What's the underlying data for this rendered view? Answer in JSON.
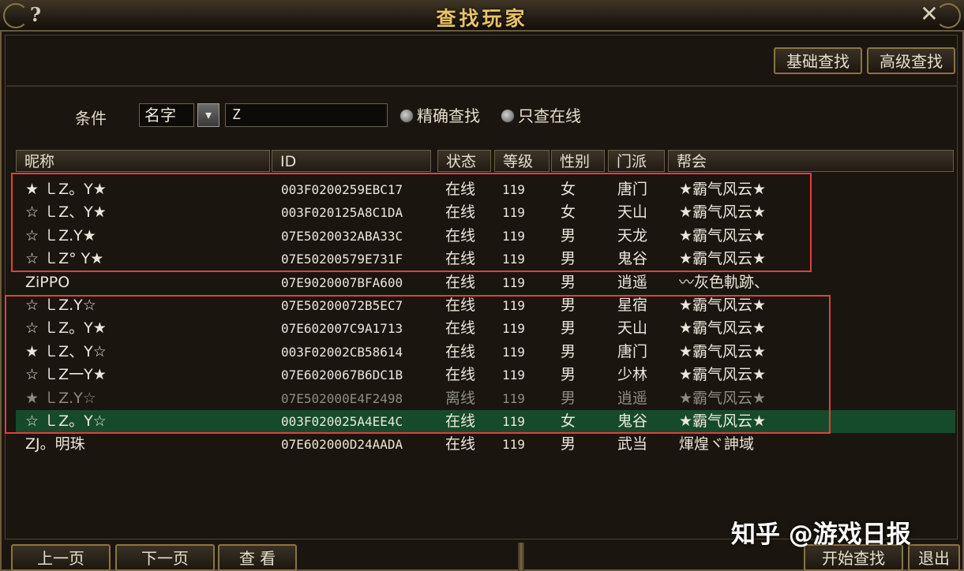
{
  "window": {
    "title": "查找玩家",
    "help_glyph": "?",
    "close_glyph": "✕"
  },
  "tabs": {
    "basic": "基础查找",
    "advanced": "高级查找"
  },
  "search": {
    "condition_label": "条件",
    "field_selected": "名字",
    "dropdown_glyph": "▾",
    "query_value": "Z",
    "exact_label": "精确查找",
    "online_only_label": "只查在线"
  },
  "table": {
    "headers": [
      "昵称",
      "ID",
      "状态",
      "等级",
      "性别",
      "门派",
      "帮会"
    ],
    "rows": [
      {
        "nick": "★ ㇄Z。Y★",
        "id": "003F0200259EBC17",
        "status": "在线",
        "level": "119",
        "gender": "女",
        "school": "唐门",
        "guild": "★霸气风云★"
      },
      {
        "nick": "☆ ㇄Z、Y★",
        "id": "003F020125A8C1DA",
        "status": "在线",
        "level": "119",
        "gender": "女",
        "school": "天山",
        "guild": "★霸气风云★"
      },
      {
        "nick": "☆ ㇄Z.Y★",
        "id": "07E5020032ABA33C",
        "status": "在线",
        "level": "119",
        "gender": "男",
        "school": "天龙",
        "guild": "★霸气风云★"
      },
      {
        "nick": "☆ ㇄Z° Y★",
        "id": "07E50200579E731F",
        "status": "在线",
        "level": "119",
        "gender": "男",
        "school": "鬼谷",
        "guild": "★霸气风云★"
      },
      {
        "nick": "ZiPPO",
        "id": "07E9020007BFA600",
        "status": "在线",
        "level": "119",
        "gender": "男",
        "school": "逍遥",
        "guild": "〰灰色軌跡、"
      },
      {
        "nick": "☆ ㇄Z.Y☆",
        "id": "07E50200072B5EC7",
        "status": "在线",
        "level": "119",
        "gender": "男",
        "school": "星宿",
        "guild": "★霸气风云★"
      },
      {
        "nick": "☆ ㇄Z。Y★",
        "id": "07E602007C9A1713",
        "status": "在线",
        "level": "119",
        "gender": "男",
        "school": "天山",
        "guild": "★霸气风云★"
      },
      {
        "nick": "★ ㇄Z、Y☆",
        "id": "003F02002CB58614",
        "status": "在线",
        "level": "119",
        "gender": "男",
        "school": "唐门",
        "guild": "★霸气风云★"
      },
      {
        "nick": "☆ ㇄Z一Y★",
        "id": "07E6020067B6DC1B",
        "status": "在线",
        "level": "119",
        "gender": "男",
        "school": "少林",
        "guild": "★霸气风云★"
      },
      {
        "nick": "★ ㇄Z.Y☆",
        "id": "07E502000E4F2498",
        "status": "离线",
        "level": "119",
        "gender": "男",
        "school": "逍遥",
        "guild": "★霸气风云★"
      },
      {
        "nick": "☆ ㇄Z。Y☆",
        "id": "003F020025A4EE4C",
        "status": "在线",
        "level": "119",
        "gender": "女",
        "school": "鬼谷",
        "guild": "★霸气风云★"
      },
      {
        "nick": "ZJ。明珠",
        "id": "07E602000D24AADA",
        "status": "在线",
        "level": "119",
        "gender": "男",
        "school": "武当",
        "guild": "煇煌ヾ訷域"
      }
    ],
    "selected_row_index": 10,
    "offline_row_index": 9,
    "highlight_color": "#e0403f",
    "selected_color": "#154b2b"
  },
  "footer": {
    "prev_page": "上一页",
    "next_page": "下一页",
    "view": "查 看",
    "start_search": "开始查找",
    "exit": "退出"
  },
  "watermark": "知乎 @游戏日报"
}
